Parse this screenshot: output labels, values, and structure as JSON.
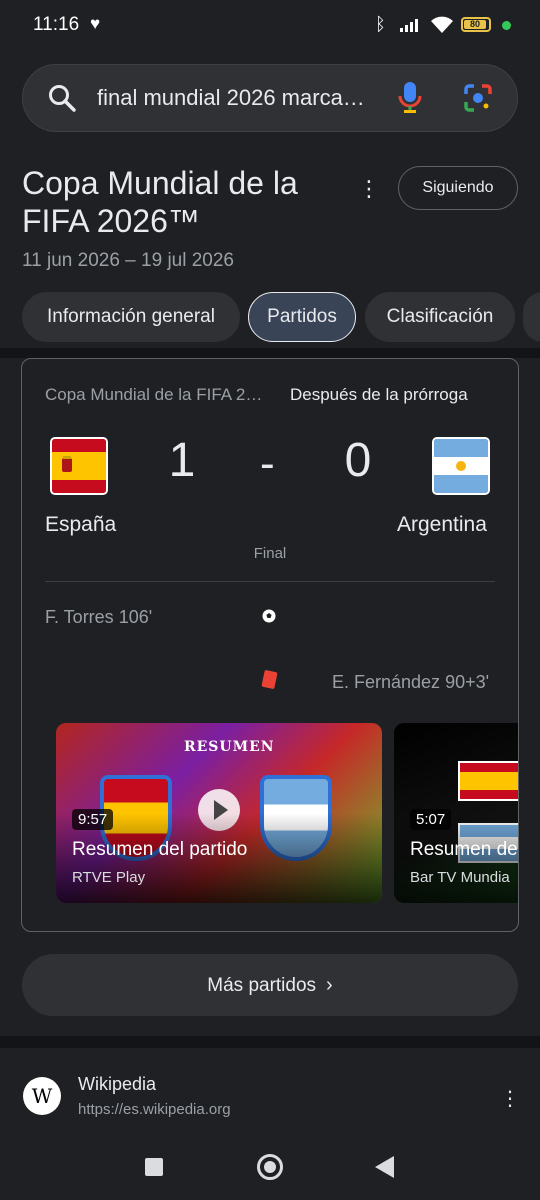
{
  "status_bar": {
    "time": "11:16",
    "battery": "80"
  },
  "search": {
    "query": "final mundial 2026 marca…"
  },
  "header": {
    "title": "Copa Mundial de la FIFA 2026™",
    "dates": "11 jun 2026 – 19 jul 2026",
    "follow_label": "Siguiendo"
  },
  "tabs": [
    {
      "label": "Información general",
      "active": false
    },
    {
      "label": "Partidos",
      "active": true
    },
    {
      "label": "Clasificación",
      "active": false
    }
  ],
  "match": {
    "competition": "Copa Mundial de la FIFA 2…",
    "status": "Después de la prórroga",
    "home_team": "España",
    "away_team": "Argentina",
    "home_score": "1",
    "separator": "-",
    "away_score": "0",
    "result_label": "Final",
    "events": [
      {
        "player": "F. Torres 106'",
        "type": "goal",
        "side": "home"
      },
      {
        "player": "E. Fernández 90+3'",
        "type": "red-card",
        "side": "away"
      }
    ],
    "videos": [
      {
        "duration": "9:57",
        "title": "Resumen del partido",
        "source": "RTVE Play",
        "banner": "RESUMEN"
      },
      {
        "duration": "5:07",
        "title": "Resumen de",
        "source": "Bar TV Mundia"
      }
    ]
  },
  "more_matches_label": "Más partidos",
  "result": {
    "site_name": "Wikipedia",
    "url": "https://es.wikipedia.org",
    "logo_letter": "W"
  },
  "colors": {
    "background": "#1f2023",
    "surface": "#303134",
    "active_tab": "#394457",
    "red_card": "#ea4335"
  }
}
